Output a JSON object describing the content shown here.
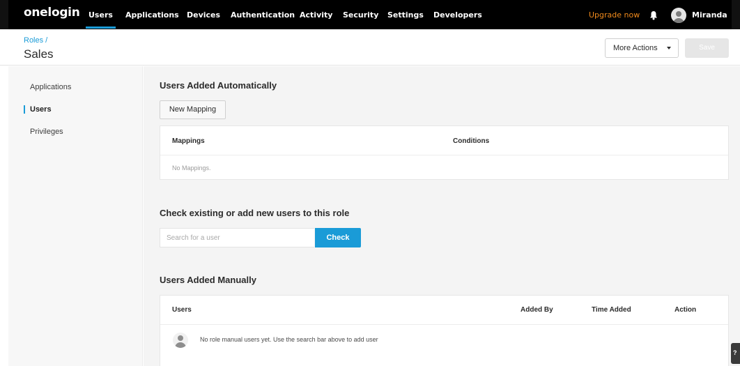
{
  "brand": {
    "logo_text": "onelogin"
  },
  "nav": {
    "items": [
      {
        "label": "Users",
        "active": true
      },
      {
        "label": "Applications",
        "active": false
      },
      {
        "label": "Devices",
        "active": false
      },
      {
        "label": "Authentication",
        "active": false
      },
      {
        "label": "Activity",
        "active": false
      },
      {
        "label": "Security",
        "active": false
      },
      {
        "label": "Settings",
        "active": false
      },
      {
        "label": "Developers",
        "active": false
      }
    ],
    "upgrade_label": "Upgrade now",
    "bell_icon": "bell-icon",
    "username": "Miranda"
  },
  "header": {
    "breadcrumb": "Roles /",
    "title": "Sales",
    "more_actions_label": "More Actions",
    "save_label": "Save"
  },
  "sidebar": {
    "items": [
      {
        "label": "Applications",
        "active": false
      },
      {
        "label": "Users",
        "active": true
      },
      {
        "label": "Privileges",
        "active": false
      }
    ]
  },
  "auto_section": {
    "title": "Users Added Automatically",
    "new_mapping_label": "New Mapping",
    "columns": [
      "Mappings",
      "Conditions"
    ],
    "empty_text": "No Mappings."
  },
  "check_section": {
    "title": "Check existing or add new users to this role",
    "search_placeholder": "Search for a user",
    "check_label": "Check"
  },
  "manual_section": {
    "title": "Users Added Manually",
    "columns": [
      "Users",
      "Added By",
      "Time Added",
      "Action"
    ],
    "empty_text": "No role manual users yet. Use the search bar above to add user"
  },
  "colors": {
    "accent": "#1a9bd7",
    "nav_bg": "#000000",
    "upgrade": "#f08a1c"
  }
}
